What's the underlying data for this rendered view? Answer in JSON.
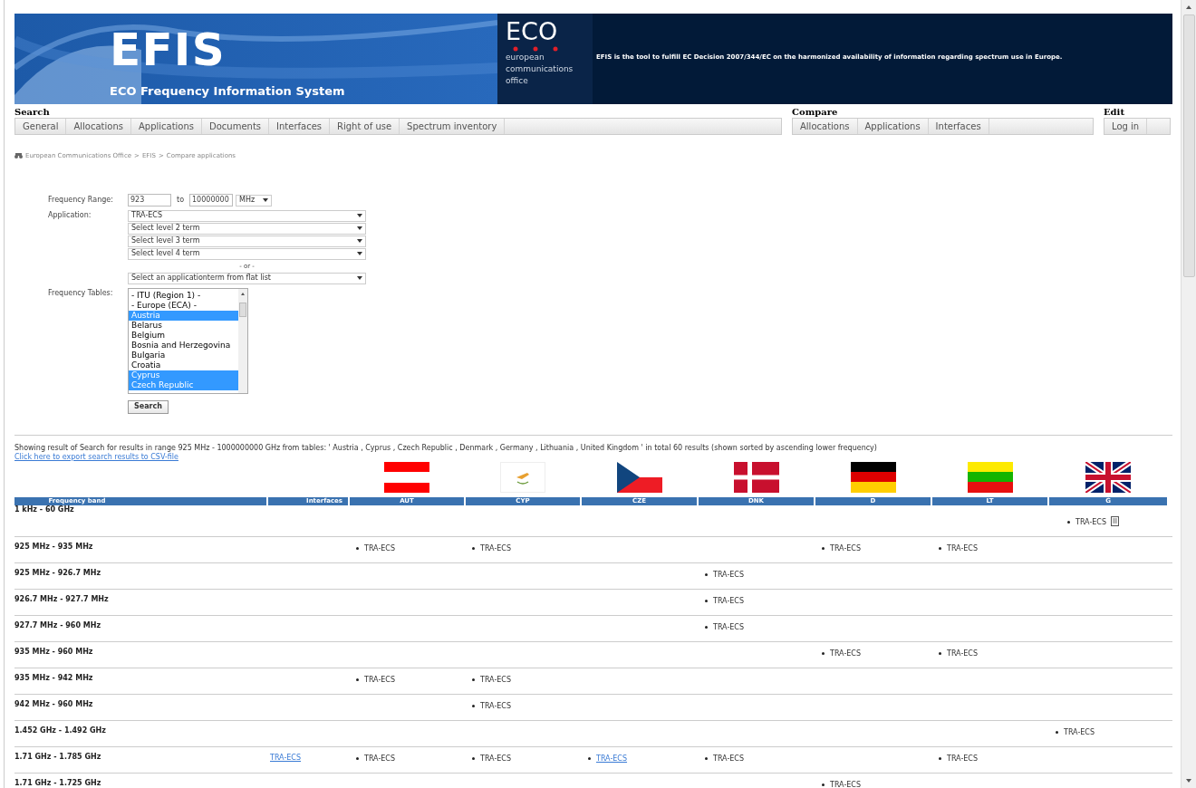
{
  "header": {
    "title": "EFIS",
    "subtitle": "ECO Frequency Information System",
    "logo_text": "ECO",
    "logo_caption": [
      "european",
      "communications",
      "office"
    ],
    "description": "EFIS is the tool to fulfill EC Decision 2007/344/EC on the harmonized availability of information regarding spectrum use in Europe."
  },
  "nav": [
    {
      "heading": "Search",
      "items": [
        "General",
        "Allocations",
        "Applications",
        "Documents",
        "Interfaces",
        "Right of use",
        "Spectrum inventory"
      ]
    },
    {
      "heading": "Compare",
      "items": [
        "Allocations",
        "Applications",
        "Interfaces"
      ]
    },
    {
      "heading": "Edit",
      "items": [
        "Log in"
      ]
    }
  ],
  "breadcrumb": {
    "items": [
      "European Communications Office",
      "EFIS",
      "Compare applications"
    ],
    "separator": ">"
  },
  "form": {
    "range_label": "Frequency Range:",
    "range_from": "923",
    "range_to_label": "to",
    "range_to": "10000000",
    "unit": "MHz",
    "application_label": "Application:",
    "application_selects": [
      "TRA-ECS",
      "Select level 2 term",
      "Select level 3 term",
      "Select level 4 term"
    ],
    "or_label": "- or -",
    "flat_list": "Select an applicationterm from flat list",
    "tables_label": "Frequency Tables:",
    "tables": [
      {
        "label": "- ITU (Region 1) -",
        "selected": false
      },
      {
        "label": "- Europe (ECA) -",
        "selected": false
      },
      {
        "label": "Austria",
        "selected": true
      },
      {
        "label": "Belarus",
        "selected": false
      },
      {
        "label": "Belgium",
        "selected": false
      },
      {
        "label": "Bosnia and Herzegovina",
        "selected": false
      },
      {
        "label": "Bulgaria",
        "selected": false
      },
      {
        "label": "Croatia",
        "selected": false
      },
      {
        "label": "Cyprus",
        "selected": true
      },
      {
        "label": "Czech Republic",
        "selected": true
      }
    ],
    "search_button": "Search"
  },
  "results": {
    "summary": "Showing result of Search for results in range 925 MHz - 1000000000 GHz from tables: ' Austria , Cyprus , Czech Republic , Denmark , Germany , Lithuania , United Kingdom ' in total 60 results (shown sorted by ascending lower frequency)",
    "export_link": "Click here to export search results to CSV-file",
    "band_column": "Frequency band",
    "interfaces_column": "Interfaces",
    "countries": [
      {
        "label": "AUT",
        "kind": "austria"
      },
      {
        "label": "CYP",
        "kind": "cyprus"
      },
      {
        "label": "CZE",
        "kind": "czech"
      },
      {
        "label": "DNK",
        "kind": "denmark"
      },
      {
        "label": "D",
        "kind": "germany"
      },
      {
        "label": "LT",
        "kind": "lithuania"
      },
      {
        "label": "G",
        "kind": "uk"
      }
    ],
    "rows": [
      {
        "band": "1 kHz - 60 GHz",
        "cells": [
          [],
          [],
          [],
          [],
          [],
          [],
          [
            {
              "text": "TRA-ECS",
              "link": false,
              "document": true
            }
          ]
        ]
      },
      {
        "band": "925 MHz - 935 MHz",
        "cells": [
          [
            {
              "text": "TRA-ECS",
              "link": false,
              "document": false
            }
          ],
          [
            {
              "text": "TRA-ECS",
              "link": false,
              "document": false
            }
          ],
          [],
          [],
          [
            {
              "text": "TRA-ECS",
              "link": false,
              "document": false
            }
          ],
          [
            {
              "text": "TRA-ECS",
              "link": false,
              "document": false
            }
          ],
          []
        ]
      },
      {
        "band": "925 MHz - 926.7 MHz",
        "cells": [
          [],
          [],
          [],
          [
            {
              "text": "TRA-ECS",
              "link": false,
              "document": false
            }
          ],
          [],
          [],
          []
        ]
      },
      {
        "band": "926.7 MHz - 927.7 MHz",
        "cells": [
          [],
          [],
          [],
          [
            {
              "text": "TRA-ECS",
              "link": false,
              "document": false
            }
          ],
          [],
          [],
          []
        ]
      },
      {
        "band": "927.7 MHz - 960 MHz",
        "cells": [
          [],
          [],
          [],
          [
            {
              "text": "TRA-ECS",
              "link": false,
              "document": false
            }
          ],
          [],
          [],
          []
        ]
      },
      {
        "band": "935 MHz - 960 MHz",
        "cells": [
          [],
          [],
          [],
          [],
          [
            {
              "text": "TRA-ECS",
              "link": false,
              "document": false
            }
          ],
          [
            {
              "text": "TRA-ECS",
              "link": false,
              "document": false
            }
          ],
          []
        ]
      },
      {
        "band": "935 MHz - 942 MHz",
        "cells": [
          [
            {
              "text": "TRA-ECS",
              "link": false,
              "document": false
            }
          ],
          [
            {
              "text": "TRA-ECS",
              "link": false,
              "document": false
            }
          ],
          [],
          [],
          [],
          [],
          []
        ]
      },
      {
        "band": "942 MHz - 960 MHz",
        "cells": [
          [],
          [
            {
              "text": "TRA-ECS",
              "link": false,
              "document": false
            }
          ],
          [],
          [],
          [],
          [],
          []
        ]
      },
      {
        "band": "1.452 GHz - 1.492 GHz",
        "cells": [
          [],
          [],
          [],
          [],
          [],
          [],
          [
            {
              "text": "TRA-ECS",
              "link": false,
              "document": false
            }
          ]
        ]
      },
      {
        "band": "1.71 GHz - 1.785 GHz",
        "interfaces": "TRA-ECS",
        "cells": [
          [
            {
              "text": "TRA-ECS",
              "link": false,
              "document": false
            }
          ],
          [
            {
              "text": "TRA-ECS",
              "link": false,
              "document": false
            }
          ],
          [
            {
              "text": "TRA-ECS",
              "link": true,
              "document": false
            }
          ],
          [
            {
              "text": "TRA-ECS",
              "link": false,
              "document": false
            }
          ],
          [],
          [
            {
              "text": "TRA-ECS",
              "link": false,
              "document": false
            }
          ],
          []
        ]
      },
      {
        "band": "1.71 GHz - 1.725 GHz",
        "cells": [
          [],
          [],
          [],
          [],
          [
            {
              "text": "TRA-ECS",
              "link": false,
              "document": false
            }
          ],
          [],
          []
        ]
      }
    ]
  }
}
